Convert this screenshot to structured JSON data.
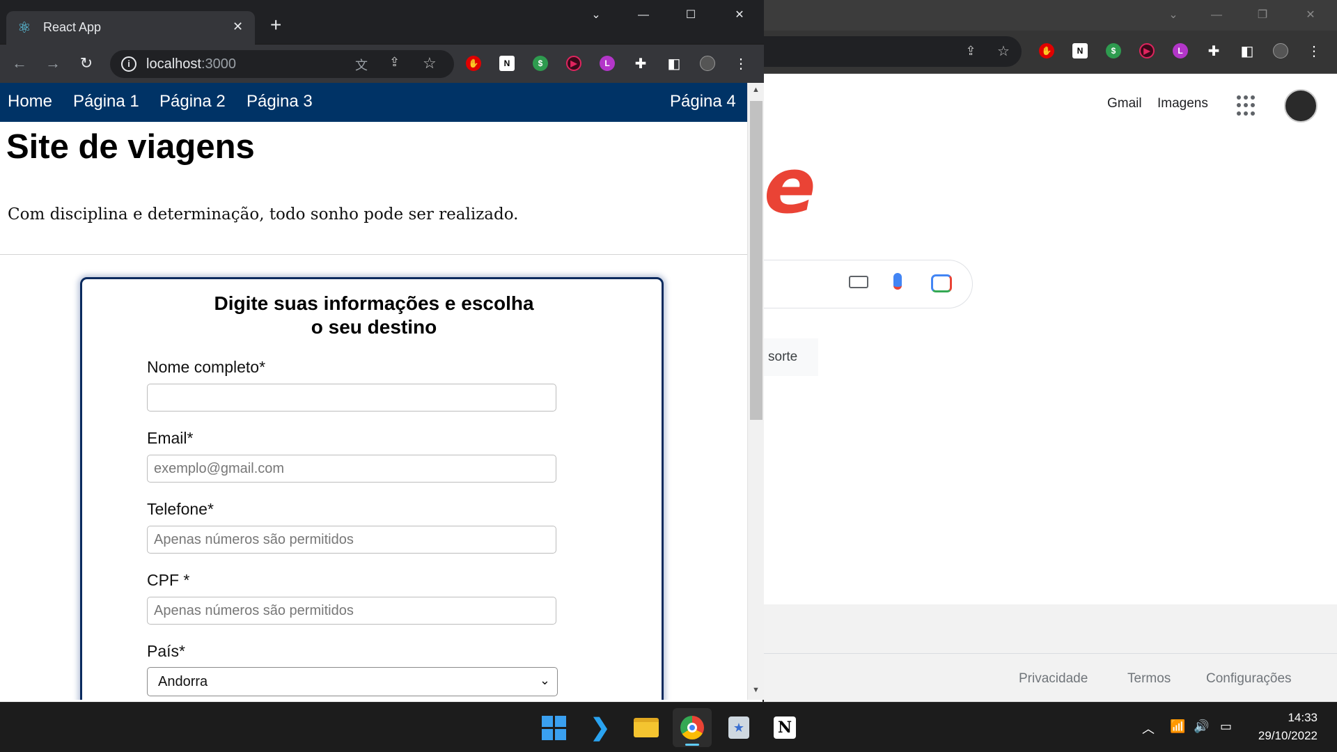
{
  "browser": {
    "tab_title": "React App",
    "url_host": "localhost",
    "url_port": ":3000"
  },
  "site": {
    "nav": [
      "Home",
      "Página 1",
      "Página 2",
      "Página 3"
    ],
    "nav_right": "Página 4",
    "title": "Site de viagens",
    "motto": "Com disciplina e determinação, todo sonho pode ser realizado.",
    "nav_bg": "#003366"
  },
  "form": {
    "title_line1": "Digite suas informações e escolha",
    "title_line2": "o seu destino",
    "fields": [
      {
        "label": "Nome completo*",
        "placeholder": ""
      },
      {
        "label": "Email*",
        "placeholder": "exemplo@gmail.com"
      },
      {
        "label": "Telefone*",
        "placeholder": "Apenas números são permitidos"
      },
      {
        "label": "CPF *",
        "placeholder": "Apenas números são permitidos"
      }
    ],
    "country_label": "País*",
    "country_value": "Andorra"
  },
  "google": {
    "gmail": "Gmail",
    "images": "Imagens",
    "lucky_fragment": "sorte",
    "footer": [
      "Privacidade",
      "Termos",
      "Configurações"
    ]
  },
  "taskbar": {
    "time": "14:33",
    "date": "29/10/2022",
    "apps": [
      "windows-start",
      "vscode",
      "file-explorer",
      "chrome",
      "app-store",
      "notion"
    ]
  }
}
